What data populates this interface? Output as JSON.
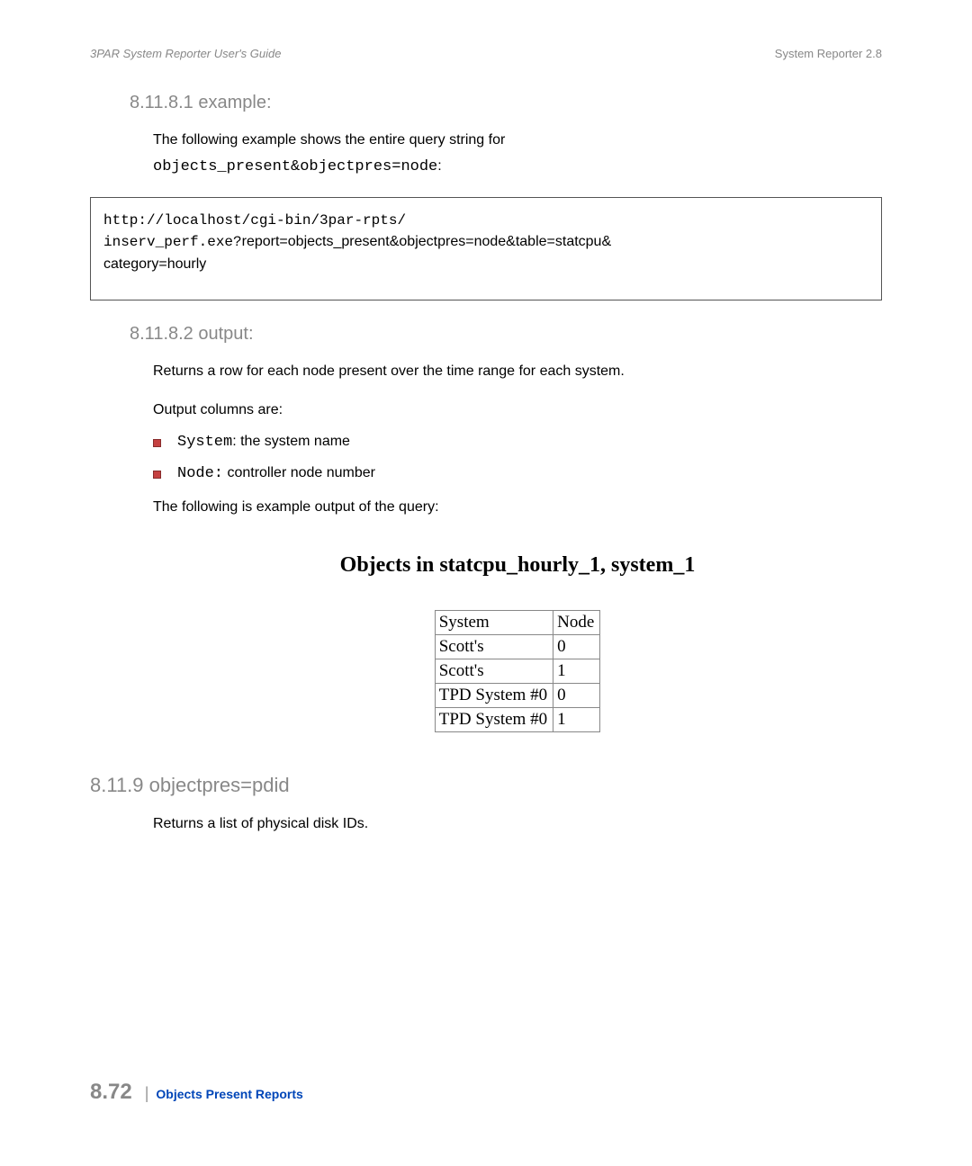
{
  "header": {
    "left": "3PAR System Reporter User's Guide",
    "right": "System Reporter 2.8"
  },
  "sec1": {
    "heading": "8.11.8.1 example:",
    "para1": "The following example shows the entire query string for",
    "code_inline": "objects_present&objectpres=node",
    "colon": ":",
    "box_line1": "http://localhost/cgi-bin/3par-rpts/",
    "box_line2_mono": "inserv_perf.exe?",
    "box_line2_rest": "report=objects_present&objectpres=node&table=statcpu&",
    "box_line3": "category=hourly"
  },
  "sec2": {
    "heading": "8.11.8.2 output:",
    "para1": "Returns a row for each node present over the time range for each system.",
    "para2": "Output columns are:",
    "items": [
      {
        "mono": "System",
        "rest": ": the system name"
      },
      {
        "mono": "Node:",
        "rest": " controller node number"
      }
    ],
    "para3": "The following is example output of the query:",
    "fig_title": "Objects in statcpu_hourly_1, system_1",
    "table": {
      "headers": [
        "System",
        "Node"
      ],
      "rows": [
        [
          "Scott's",
          "0"
        ],
        [
          "Scott's",
          "1"
        ],
        [
          "TPD System #0",
          "0"
        ],
        [
          "TPD System #0",
          "1"
        ]
      ]
    }
  },
  "sec3": {
    "heading": "8.11.9 objectpres=pdid",
    "para": "Returns a list of physical disk IDs."
  },
  "footer": {
    "page": "8.72",
    "link": "Objects Present Reports"
  }
}
